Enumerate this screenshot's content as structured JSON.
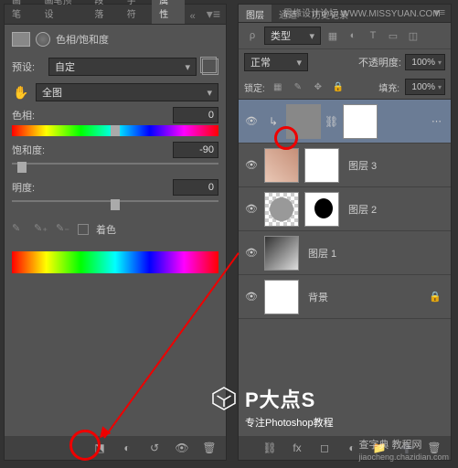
{
  "watermarks": {
    "top_cn": "思缘设计论坛",
    "top_url": "WWW.MISSYUAN.COM",
    "bottom": "查字典 教程网",
    "bottom_url": "jiaocheng.chazidian.com"
  },
  "logo": {
    "title": "P大点S",
    "subtitle": "专注Photoshop教程"
  },
  "left": {
    "tabs": [
      "画笔",
      "画笔预设",
      "段落",
      "字符",
      "属性"
    ],
    "active_tab": "属性",
    "header_title": "色相/饱和度",
    "preset": {
      "label": "预设:",
      "value": "自定"
    },
    "channel": {
      "value": "全图"
    },
    "hue": {
      "label": "色相:",
      "value": "0"
    },
    "sat": {
      "label": "饱和度:",
      "value": "-90"
    },
    "light": {
      "label": "明度:",
      "value": "0"
    },
    "colorize": "着色"
  },
  "right": {
    "tabs": [
      "图层",
      "通道",
      "历史记录"
    ],
    "active_tab": "图层",
    "type_label": "类型",
    "blend": {
      "mode": "正常",
      "opacity_label": "不透明度:",
      "opacity": "100%"
    },
    "lock": {
      "label": "锁定:",
      "fill_label": "填充:",
      "fill": "100%"
    },
    "layers": [
      {
        "name": "",
        "selected": true,
        "clip": true
      },
      {
        "name": "图层 3"
      },
      {
        "name": "图层 2"
      },
      {
        "name": "图层 1"
      },
      {
        "name": "背景"
      }
    ]
  }
}
